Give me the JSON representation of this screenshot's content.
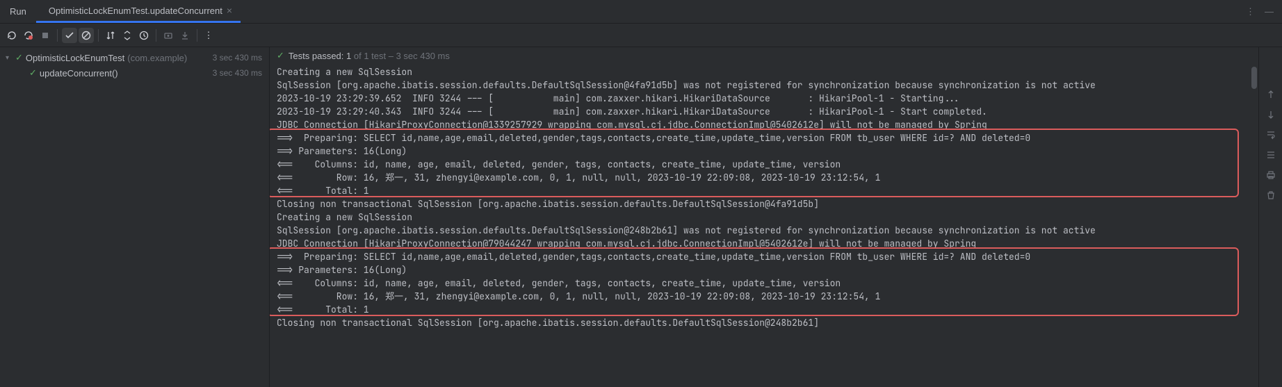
{
  "tabs": {
    "run_label": "Run",
    "test_label": "OptimisticLockEnumTest.updateConcurrent"
  },
  "tree": {
    "root_label": "OptimisticLockEnumTest",
    "root_pkg": "(com.example)",
    "root_time": "3 sec 430 ms",
    "child_label": "updateConcurrent()",
    "child_time": "3 sec 430 ms"
  },
  "header": {
    "passed_prefix": "Tests passed: ",
    "passed_count": "1",
    "tail": " of 1 test – 3 sec 430 ms"
  },
  "console": {
    "l01": "Creating a new SqlSession",
    "l02": "SqlSession [org.apache.ibatis.session.defaults.DefaultSqlSession@4fa91d5b] was not registered for synchronization because synchronization is not active",
    "l03": "2023-10-19 23:29:39.652  INFO 3244 --- [           main] com.zaxxer.hikari.HikariDataSource       : HikariPool-1 - Starting...",
    "l04": "2023-10-19 23:29:40.343  INFO 3244 --- [           main] com.zaxxer.hikari.HikariDataSource       : HikariPool-1 - Start completed.",
    "l05": "JDBC Connection [HikariProxyConnection@1339257929 wrapping com.mysql.cj.jdbc.ConnectionImpl@5402612e] will not be managed by Spring",
    "l06": "==>  Preparing: SELECT id,name,age,email,deleted,gender,tags,contacts,create_time,update_time,version FROM tb_user WHERE id=? AND deleted=0",
    "l07": "==> Parameters: 16(Long)",
    "l08": "<==    Columns: id, name, age, email, deleted, gender, tags, contacts, create_time, update_time, version",
    "l09": "<==        Row: 16, 郑一, 31, zhengyi@example.com, 0, 1, null, null, 2023-10-19 22:09:08, 2023-10-19 23:12:54, 1",
    "l10": "<==      Total: 1",
    "l11": "Closing non transactional SqlSession [org.apache.ibatis.session.defaults.DefaultSqlSession@4fa91d5b]",
    "l12": "Creating a new SqlSession",
    "l13": "SqlSession [org.apache.ibatis.session.defaults.DefaultSqlSession@248b2b61] was not registered for synchronization because synchronization is not active",
    "l14": "JDBC Connection [HikariProxyConnection@79044247 wrapping com.mysql.cj.jdbc.ConnectionImpl@5402612e] will not be managed by Spring",
    "l15": "==>  Preparing: SELECT id,name,age,email,deleted,gender,tags,contacts,create_time,update_time,version FROM tb_user WHERE id=? AND deleted=0",
    "l16": "==> Parameters: 16(Long)",
    "l17": "<==    Columns: id, name, age, email, deleted, gender, tags, contacts, create_time, update_time, version",
    "l18": "<==        Row: 16, 郑一, 31, zhengyi@example.com, 0, 1, null, null, 2023-10-19 22:09:08, 2023-10-19 23:12:54, 1",
    "l19": "<==      Total: 1",
    "l20": "Closing non transactional SqlSession [org.apache.ibatis.session.defaults.DefaultSqlSession@248b2b61]"
  }
}
